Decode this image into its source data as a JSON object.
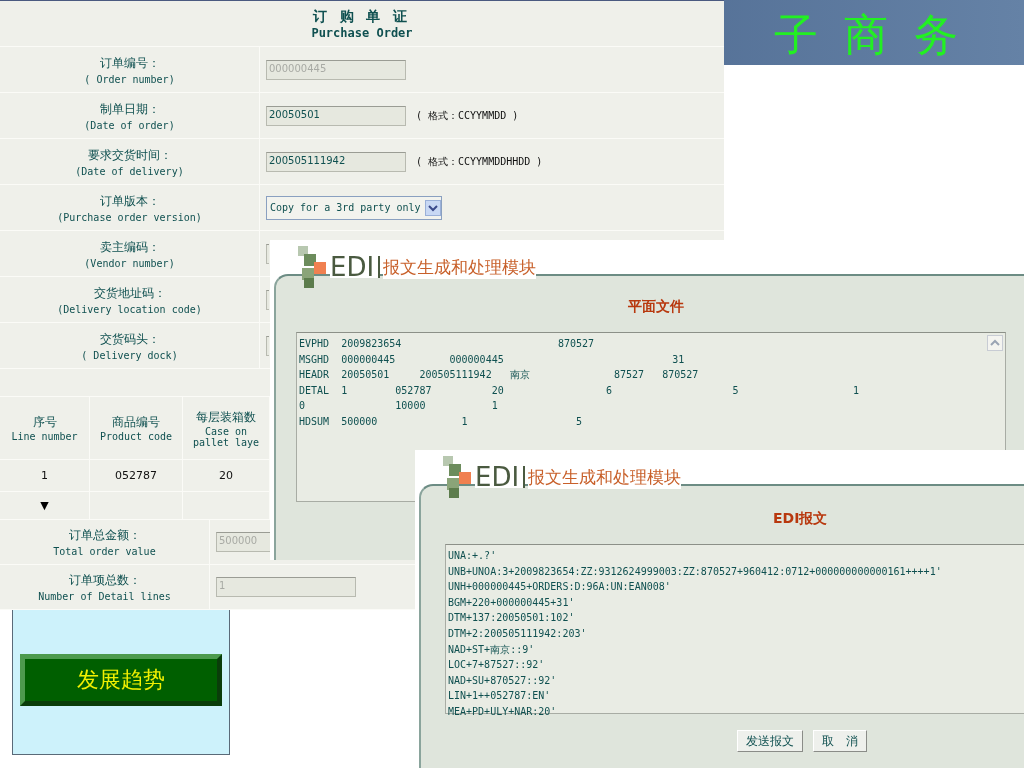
{
  "banner": {
    "title": "子 商 务"
  },
  "order_form": {
    "title": "订 购 单 证",
    "subtitle": "Purchase Order",
    "fields": [
      {
        "label": "订单编号：",
        "label_en": "( Order number)",
        "kind": "input",
        "value": "000000445",
        "disabled": true
      },
      {
        "label": "制单日期：",
        "label_en": "(Date of order)",
        "kind": "input",
        "value": "20050501",
        "disabled": false,
        "hint": "( 格式：CCYYMMDD )"
      },
      {
        "label": "要求交货时间：",
        "label_en": "(Date of delivery)",
        "kind": "input",
        "value": "200505111942",
        "disabled": false,
        "hint": "( 格式：CCYYMMDDHHDD )"
      },
      {
        "label": "订单版本：",
        "label_en": "(Purchase order version)",
        "kind": "select",
        "value": "Copy for a 3rd party only"
      },
      {
        "label": "卖主编码：",
        "label_en": "(Vendor number)",
        "kind": "input"
      },
      {
        "label": "交货地址码：",
        "label_en": "(Delivery location code)",
        "kind": "input"
      },
      {
        "label": "交货码头：",
        "label_en": "( Delivery dock)",
        "kind": "input"
      }
    ],
    "lines_table": {
      "columns": [
        {
          "label": "序号",
          "label_en": "Line number"
        },
        {
          "label": "商品编号",
          "label_en": "Product code"
        },
        {
          "label": "每层装箱数",
          "label_en": "Case on\npallet laye"
        }
      ],
      "rows": [
        [
          "1",
          "052787",
          "20"
        ]
      ],
      "expand_marker": "▼"
    },
    "totals": [
      {
        "label": "订单总金额：",
        "label_en": "Total order value",
        "value": "500000",
        "disabled": true
      },
      {
        "label": "订单项总数：",
        "label_en": "Number of Detail lines",
        "value": "1",
        "disabled": true
      }
    ]
  },
  "side_panel": {
    "button": "发展趋势"
  },
  "edi_windows": [
    {
      "logo_text": "EDI",
      "module_title": "报文生成和处理模块",
      "panel_title": "平面文件",
      "scrollbar": true,
      "lines": [
        "EVPHD  2009823654                          870527",
        "MSGHD  000000445         000000445                            31",
        "HEADR  20050501     200505111942   南京              87527   870527",
        "DETAL  1        052787          20                 6                    5                   1",
        "0               10000           1",
        "HDSUM  500000              1                  5"
      ]
    },
    {
      "logo_text": "EDI",
      "module_title": "报文生成和处理模块",
      "panel_title": "EDI报文",
      "lines": [
        "UNA:+.?'",
        "UNB+UNOA:3+2009823654:ZZ:9312624999003:ZZ:870527+960412:0712+000000000000161++++1'",
        "UNH+000000445+ORDERS:D:96A:UN:EAN008'",
        "BGM+220+000000445+31'",
        "DTM+137:20050501:102'",
        "DTM+2:200505111942:203'",
        "NAD+ST+南京::9'",
        "LOC+7+87527::92'",
        "NAD+SU+870527::92'",
        "LIN+1++052787:EN'",
        "MEA+PD+ULY+NAR:20'"
      ],
      "buttons": [
        "发送报文",
        "取　消"
      ]
    }
  ]
}
